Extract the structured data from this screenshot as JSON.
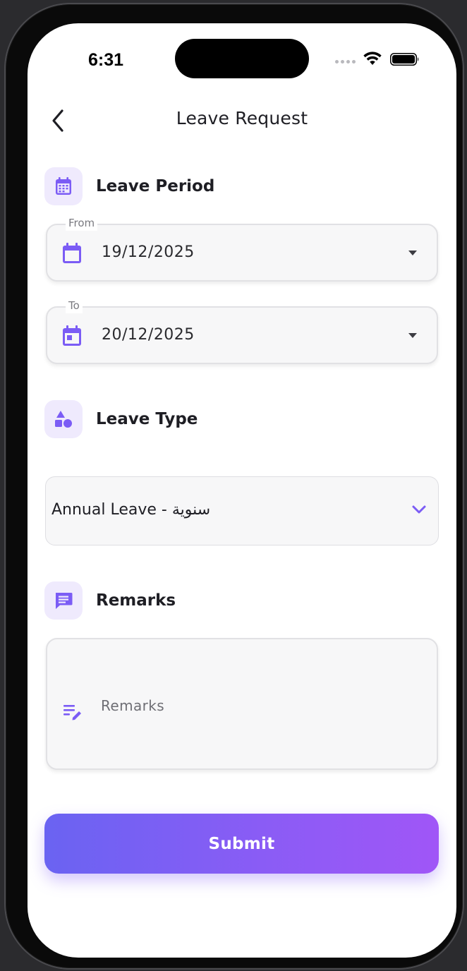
{
  "status_bar": {
    "time": "6:31"
  },
  "header": {
    "title": "Leave Request",
    "back_icon": "chevron-left-icon"
  },
  "leave_period": {
    "heading": "Leave Period",
    "icon": "calendar-grid-icon",
    "from": {
      "label": "From",
      "value": "19/12/2025",
      "icon": "calendar-icon"
    },
    "to": {
      "label": "To",
      "value": "20/12/2025",
      "icon": "calendar-day-icon"
    }
  },
  "leave_type": {
    "heading": "Leave Type",
    "icon": "shapes-icon",
    "selected": "Annual Leave - سنوية"
  },
  "remarks": {
    "heading": "Remarks",
    "icon": "message-icon",
    "field_icon": "edit-note-icon",
    "placeholder": "Remarks",
    "value": ""
  },
  "submit": {
    "label": "Submit"
  },
  "colors": {
    "accent": "#7b5cf5",
    "icon_bg": "#efeafd",
    "gradient_start": "#6a63f2",
    "gradient_end": "#a056f7"
  }
}
